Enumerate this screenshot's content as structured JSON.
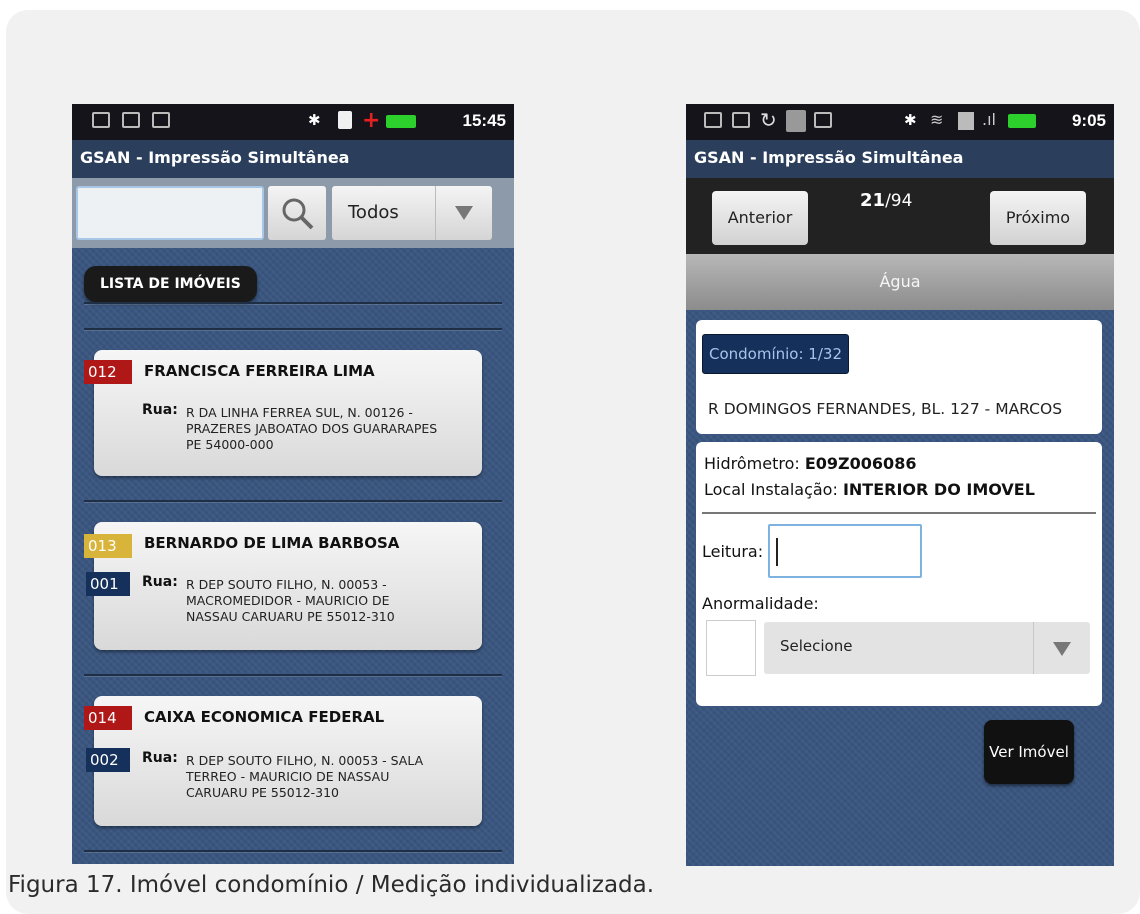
{
  "left_phone": {
    "status_time": "15:45",
    "app_title": "GSAN - Impressão Simultânea",
    "filter_selected": "Todos",
    "list_header": "LISTA DE IMÓVEIS",
    "rua_label": "Rua:",
    "cards": [
      {
        "badge": "012",
        "badge_color": "#b01818",
        "name": "FRANCISCA FERREIRA LIMA",
        "sub_badge": "",
        "addr1": "R DA LINHA FERREA SUL, N. 00126 -",
        "addr2": "PRAZERES JABOATAO DOS GUARARAPES",
        "addr3": "PE 54000-000"
      },
      {
        "badge": "013",
        "badge_color": "#d9b43a",
        "name": "BERNARDO DE LIMA BARBOSA",
        "sub_badge": "001",
        "addr1": "R DEP SOUTO FILHO, N. 00053 -",
        "addr2": "MACROMEDIDOR - MAURICIO DE",
        "addr3": "NASSAU CARUARU PE 55012-310"
      },
      {
        "badge": "014",
        "badge_color": "#b01818",
        "name": "CAIXA ECONOMICA FEDERAL",
        "sub_badge": "002",
        "addr1": "R DEP SOUTO FILHO, N. 00053 - SALA",
        "addr2": "TERREO - MAURICIO DE NASSAU",
        "addr3": "CARUARU PE 55012-310"
      }
    ]
  },
  "right_phone": {
    "status_time": "9:05",
    "app_title": "GSAN - Impressão Simultânea",
    "prev_label": "Anterior",
    "next_label": "Próximo",
    "pager_current": "21",
    "pager_total": "/94",
    "tab_label": "Água",
    "condo_badge": "Condomínio: 1/32",
    "address": "R DOMINGOS FERNANDES, BL. 127 - MARCOS",
    "hidrometro_label": "Hidrômetro:",
    "hidrometro_value": "E09Z006086",
    "local_label": "Local Instalação:",
    "local_value": "INTERIOR DO IMOVEL",
    "leitura_label": "Leitura:",
    "anormalidade_label": "Anormalidade:",
    "anormalidade_selected": "Selecione",
    "ver_imovel_label": "Ver Imóvel"
  },
  "caption": "Figura 17. Imóvel condomínio / Medição individualizada."
}
